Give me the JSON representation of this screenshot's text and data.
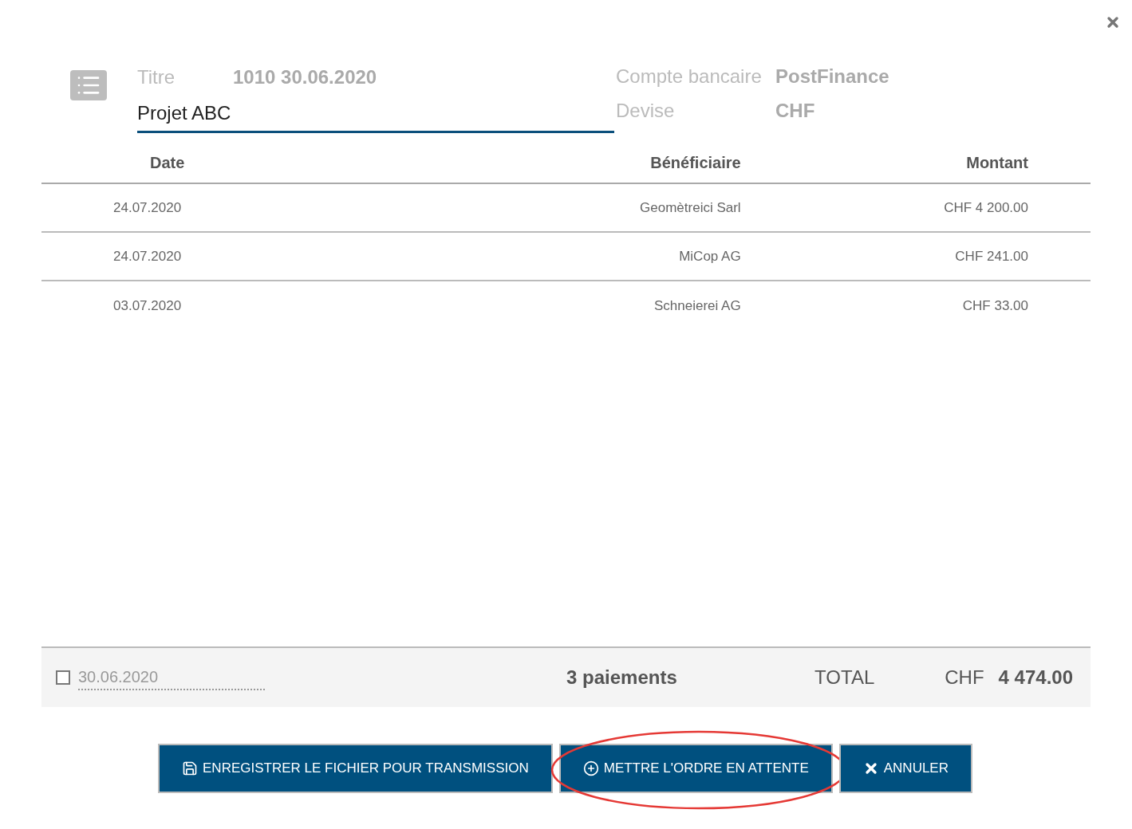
{
  "header": {
    "title_label": "Titre",
    "title_value": "1010 30.06.2020",
    "name_input": {
      "value": "Projet ABC"
    },
    "info": [
      {
        "label": "Compte bancaire",
        "value": "PostFinance"
      },
      {
        "label": "Devise",
        "value": "CHF"
      }
    ]
  },
  "table": {
    "columns": [
      "Date",
      "Bénéficiaire",
      "Montant"
    ],
    "rows": [
      [
        "24.07.2020",
        "Geomètreici Sarl",
        "CHF 4 200.00"
      ],
      [
        "24.07.2020",
        "MiCop AG",
        "CHF 241.00"
      ],
      [
        "03.07.2020",
        "Schneierei AG",
        "CHF 33.00"
      ]
    ]
  },
  "footer": {
    "checkbox": {
      "checked": false
    },
    "date": {
      "value": "30.06.2020"
    },
    "count": "3 paiements",
    "total_label": "TOTAL",
    "currency": "CHF",
    "total": "4 474.00"
  },
  "buttons": [
    {
      "kind": "save",
      "label": "ENREGISTRER LE FICHIER POUR TRANSMISSION",
      "highlighted": false
    },
    {
      "kind": "add",
      "label": "METTRE L'ORDRE EN ATTENTE",
      "highlighted": true
    },
    {
      "kind": "cancel",
      "label": "ANNULER",
      "highlighted": false
    }
  ]
}
